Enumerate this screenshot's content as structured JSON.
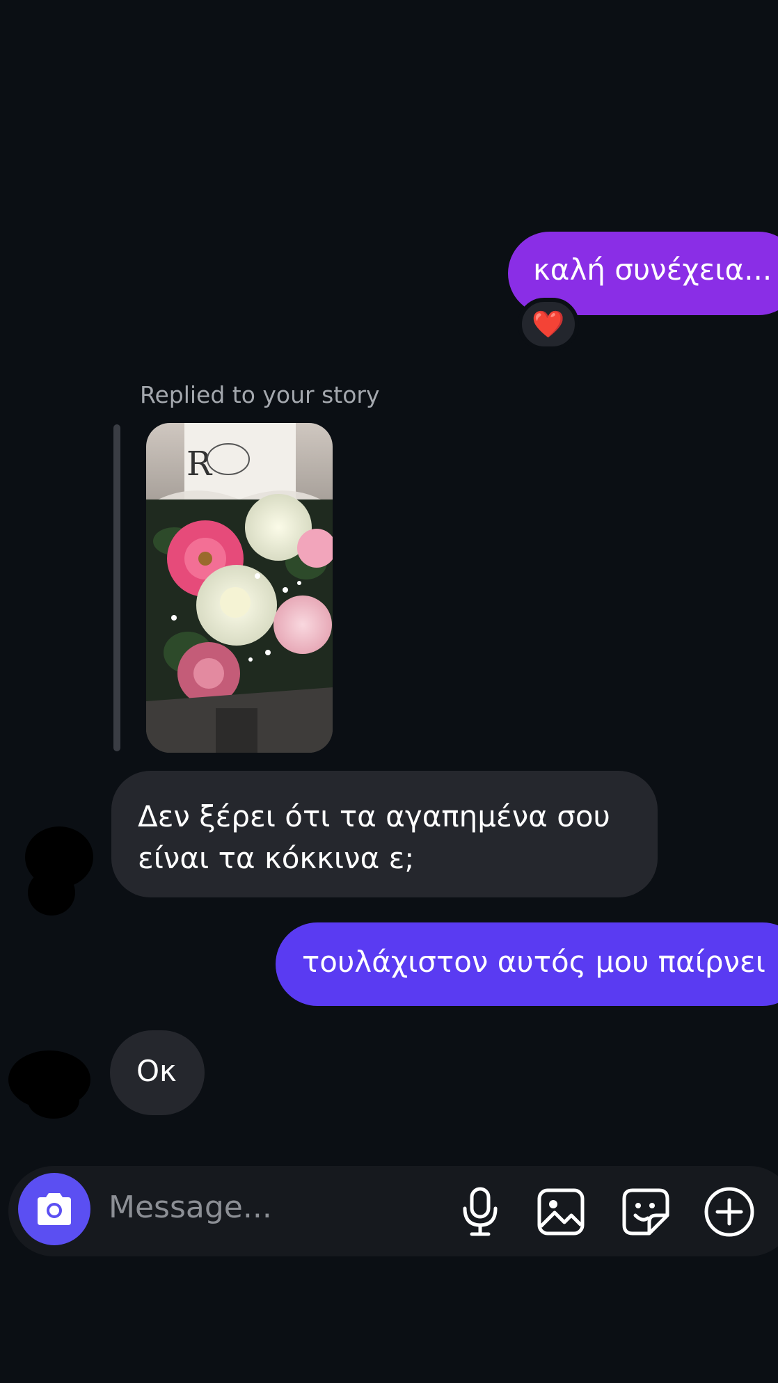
{
  "messages": {
    "out_1": "καλή συνέχεια...",
    "reaction": "❤️",
    "story_reply_label": "Replied to your story",
    "in_1_line1": "Δεν ξέρει ότι τα αγαπημένα σου",
    "in_1_line2": "είναι τα κόκκινα ε;",
    "out_2": "τουλάχιστον αυτός μου παίρνει",
    "in_2": "Οκ"
  },
  "composer": {
    "placeholder": "Message..."
  },
  "icons": {
    "camera": "camera-icon",
    "mic": "microphone-icon",
    "gallery": "gallery-icon",
    "sticker": "sticker-icon",
    "plus": "plus-icon"
  },
  "colors": {
    "background": "#0b0f14",
    "outgoing_bubble_1": "#8a2ee6",
    "outgoing_bubble_2": "#5a3bf2",
    "incoming_bubble": "#25272d",
    "camera_button": "#5b4ff2"
  }
}
